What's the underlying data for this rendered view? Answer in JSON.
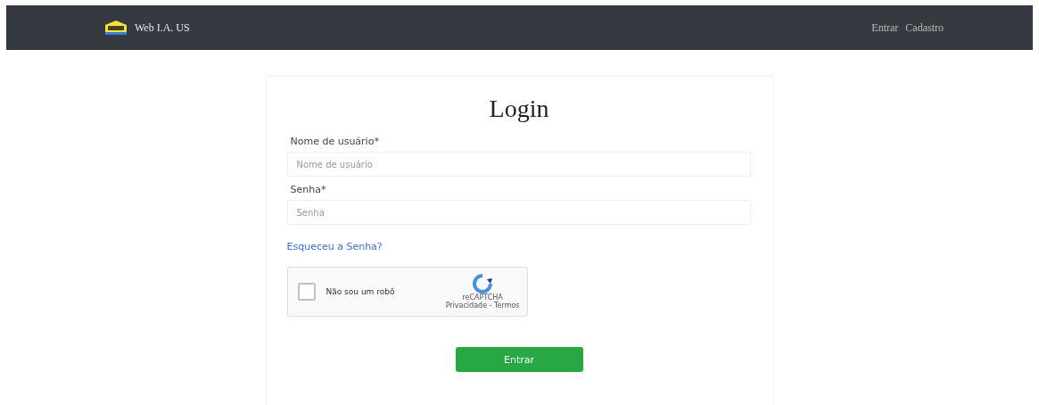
{
  "navbar": {
    "brand": "Web I.A. US",
    "links": [
      "Entrar",
      "Cadastro"
    ]
  },
  "login": {
    "title": "Login",
    "fields": [
      {
        "label": "Nome de usuário*",
        "placeholder": "Nome de usuário"
      },
      {
        "label": "Senha*",
        "placeholder": "Senha"
      }
    ],
    "forgot_link": "Esqueceu a Senha?",
    "captcha": {
      "label": "Não sou um robô",
      "checked": false,
      "brand": "reCAPTCHA",
      "terms": "Privacidade - Termos"
    },
    "submit": "Entrar"
  }
}
